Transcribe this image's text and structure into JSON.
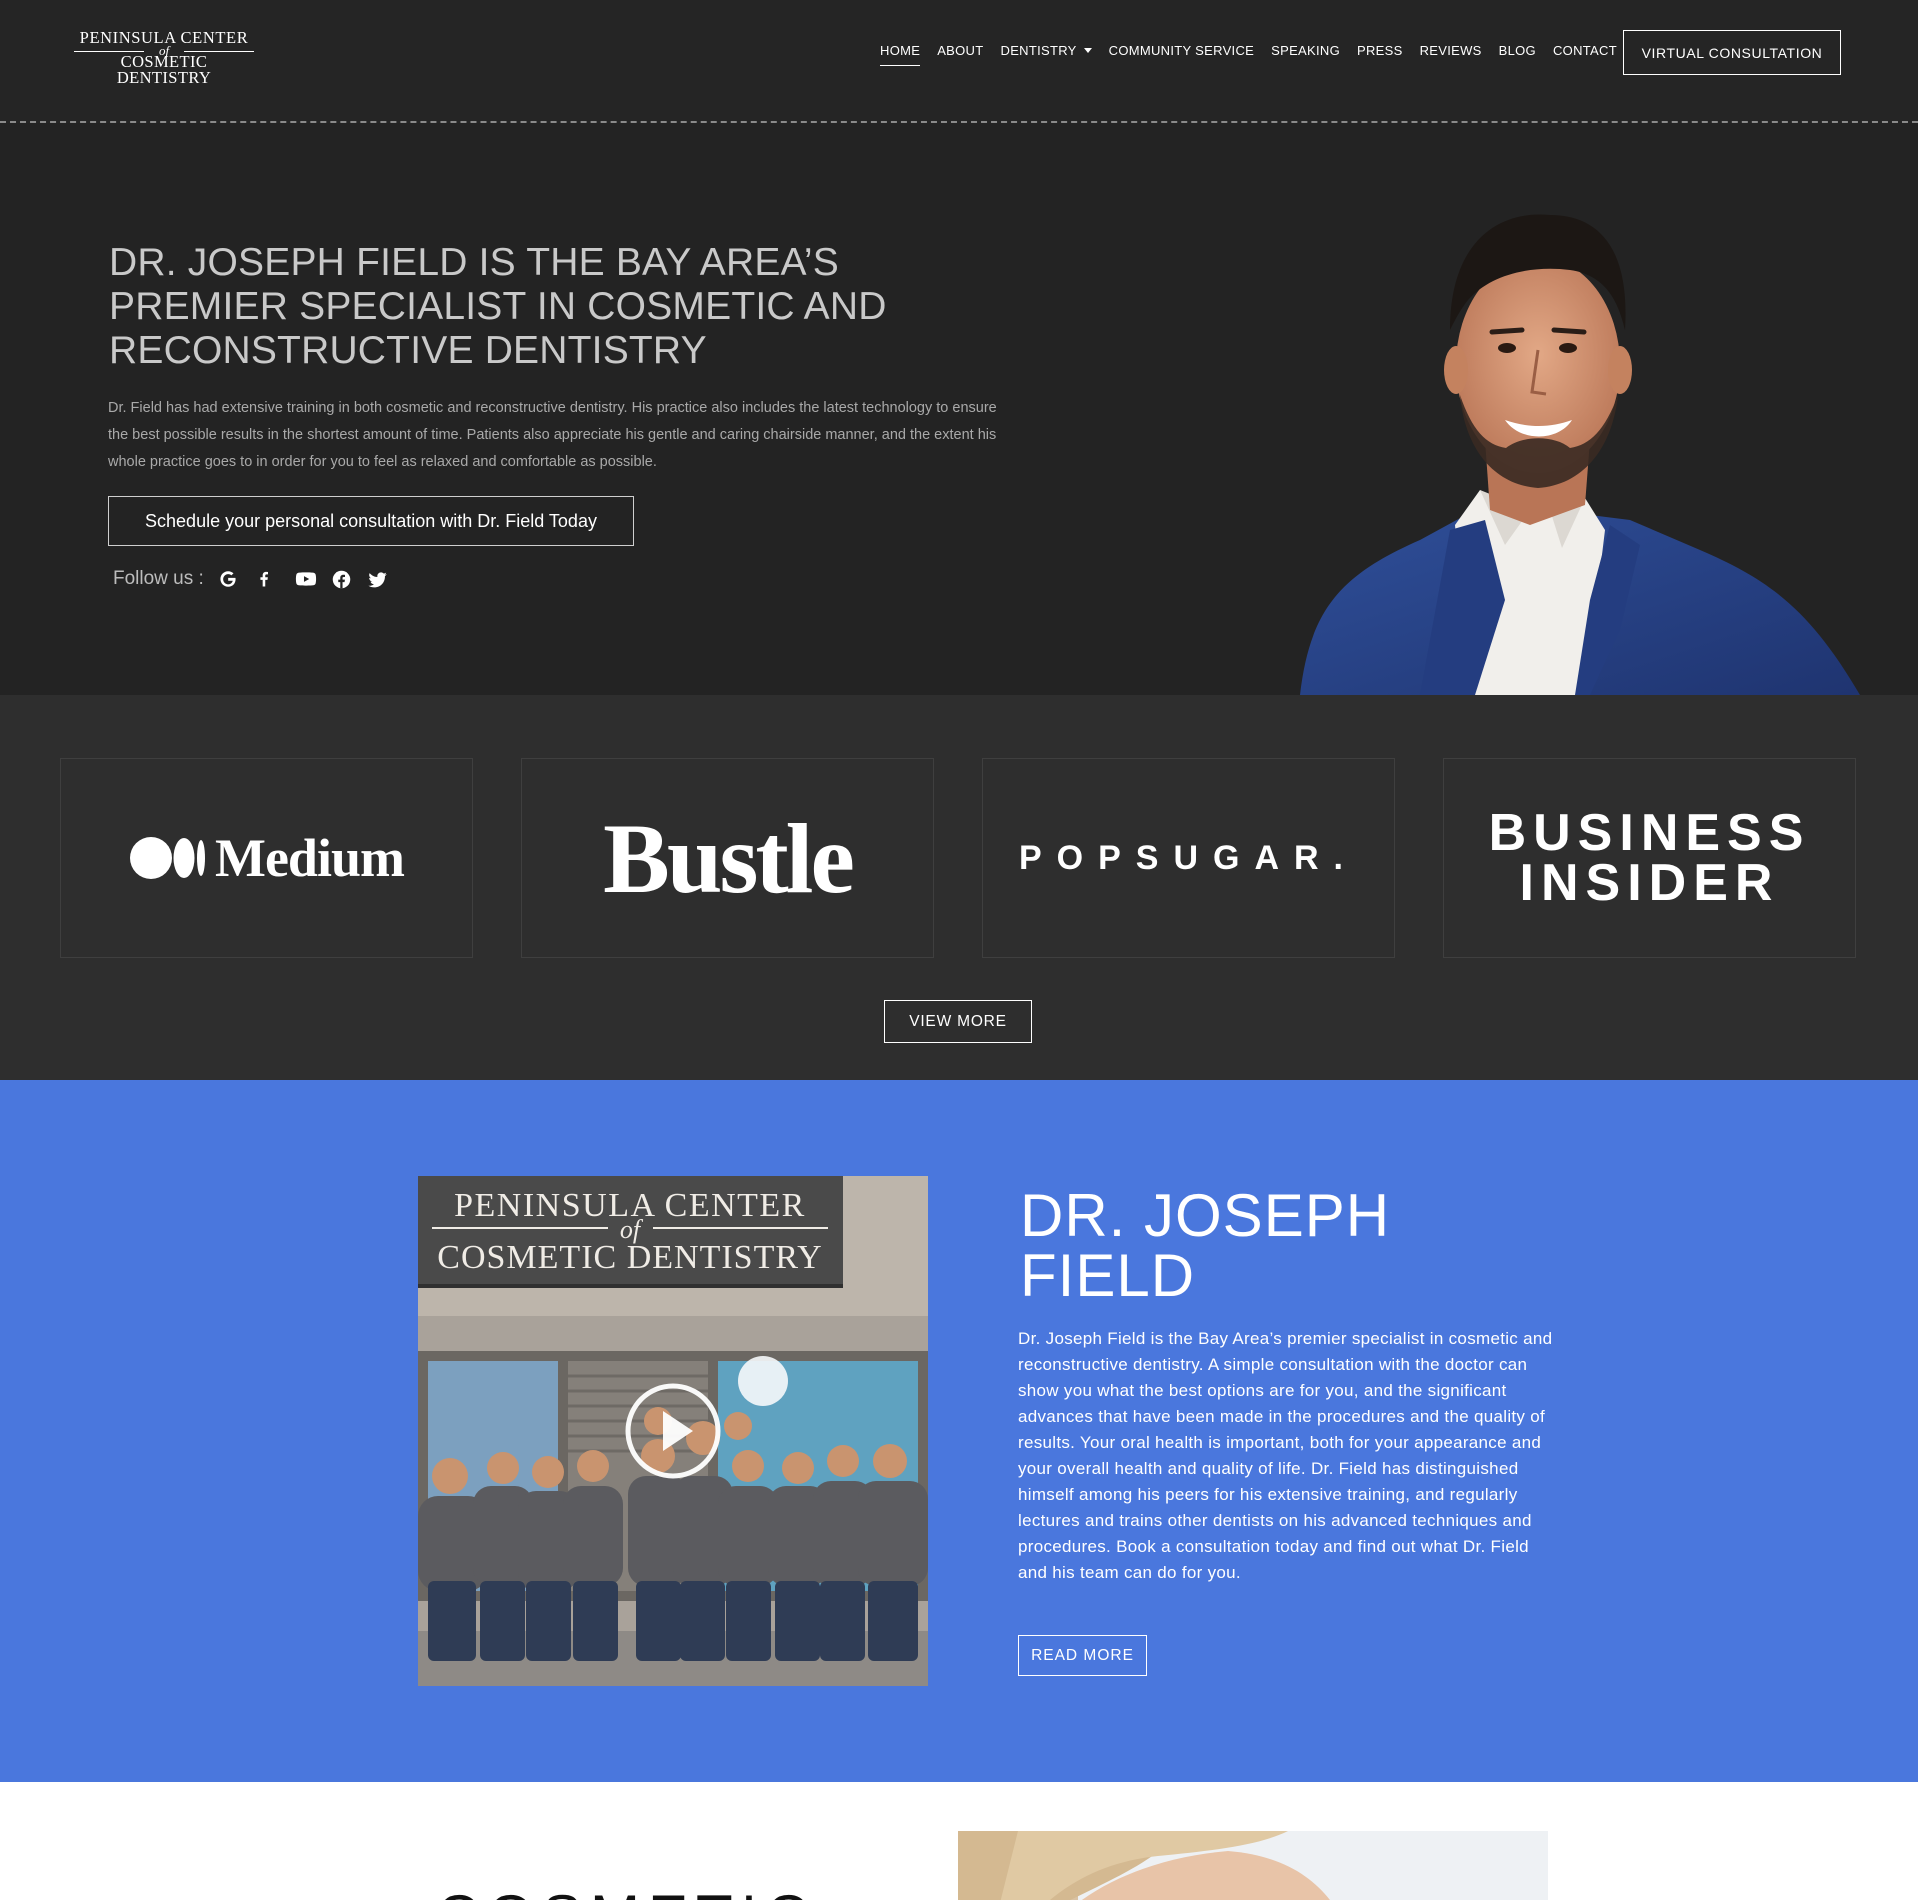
{
  "brand": {
    "logo_line1": "PENINSULA CENTER",
    "logo_line2": "of",
    "logo_line3": "COSMETIC DENTISTRY"
  },
  "nav": {
    "items": [
      {
        "label": "HOME",
        "active": true
      },
      {
        "label": "ABOUT"
      },
      {
        "label": "DENTISTRY",
        "has_dropdown": true
      },
      {
        "label": "COMMUNITY SERVICE"
      },
      {
        "label": "SPEAKING"
      },
      {
        "label": "PRESS"
      },
      {
        "label": "REVIEWS"
      },
      {
        "label": "BLOG"
      },
      {
        "label": "CONTACT"
      }
    ],
    "cta": "VIRTUAL CONSULTATION"
  },
  "hero": {
    "title": "DR. JOSEPH FIELD IS THE BAY AREA’S PREMIER SPECIALIST IN COSMETIC AND RECONSTRUCTIVE DENTISTRY",
    "text": "Dr. Field has had extensive training in both cosmetic and reconstructive dentistry. His practice also includes the latest technology to ensure the best possible results in the shortest amount of time. Patients also appreciate his gentle and caring chairside manner, and the extent his whole practice goes to in order for you to feel as relaxed and comfortable as possible.",
    "cta": "Schedule your personal consultation with Dr. Field Today",
    "follow_label": "Follow us :",
    "social": [
      "google-icon",
      "facebook-icon",
      "youtube-icon",
      "facebook-circle-icon",
      "twitter-icon"
    ]
  },
  "press": {
    "logos": [
      "Medium",
      "Bustle",
      "POPSUGAR.",
      "BUSINESS",
      "INSIDER"
    ],
    "view_more": "VIEW MORE"
  },
  "about": {
    "video_sign_line1": "PENINSULA CENTER",
    "video_sign_line2": "of",
    "video_sign_line3": "COSMETIC DENTISTRY",
    "title_line1": "DR. JOSEPH",
    "title_line2": "FIELD",
    "text": "Dr. Joseph Field is the Bay Area’s premier specialist in cosmetic and reconstructive dentistry. A simple consultation with the doctor can show you what the best options are for you, and the significant advances that have been made in the procedures and the quality of results. Your oral health is important, both for your appearance and your overall health and quality of life. Dr. Field has distinguished himself among his peers for his extensive training, and regularly lectures and trains other dentists on his advanced techniques and procedures. Book a consultation today and find out what Dr. Field and his team can do for you.",
    "read_more": "READ MORE"
  },
  "next_section": {
    "heading_partial": "COSMETIC"
  },
  "colors": {
    "header_bg": "#252525",
    "hero_bg": "#232323",
    "press_bg": "#2e2e2e",
    "about_bg": "#4a77dd",
    "suit_blue": "#2b4688"
  }
}
